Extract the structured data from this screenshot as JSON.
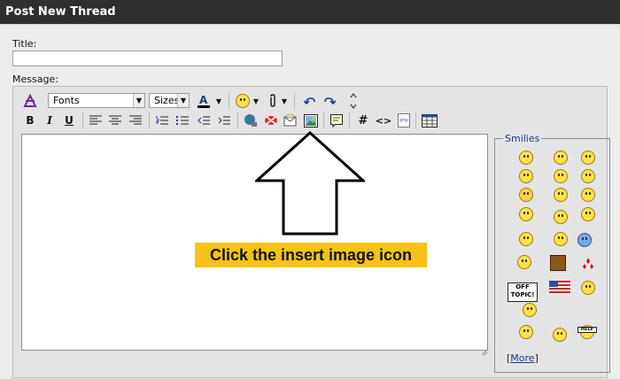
{
  "header": {
    "title": "Post New Thread"
  },
  "form": {
    "title_label": "Title:",
    "message_label": "Message:"
  },
  "toolbar": {
    "fonts_select": "Fonts",
    "sizes_select": "Sizes",
    "bold": "B",
    "italic": "I",
    "underline": "U",
    "hash": "#",
    "code": "<>",
    "php": "php"
  },
  "callout": {
    "text": "Click the insert image icon"
  },
  "smilies": {
    "legend": "Smilies",
    "more_open": "[",
    "more_link": "More",
    "more_close": "]",
    "off_topic": "OFF TOPIC!",
    "help": "HELP"
  },
  "colors": {
    "header_bg": "#2f2f2f",
    "callout_bg": "#f5c315",
    "link": "#1b3a8c"
  }
}
